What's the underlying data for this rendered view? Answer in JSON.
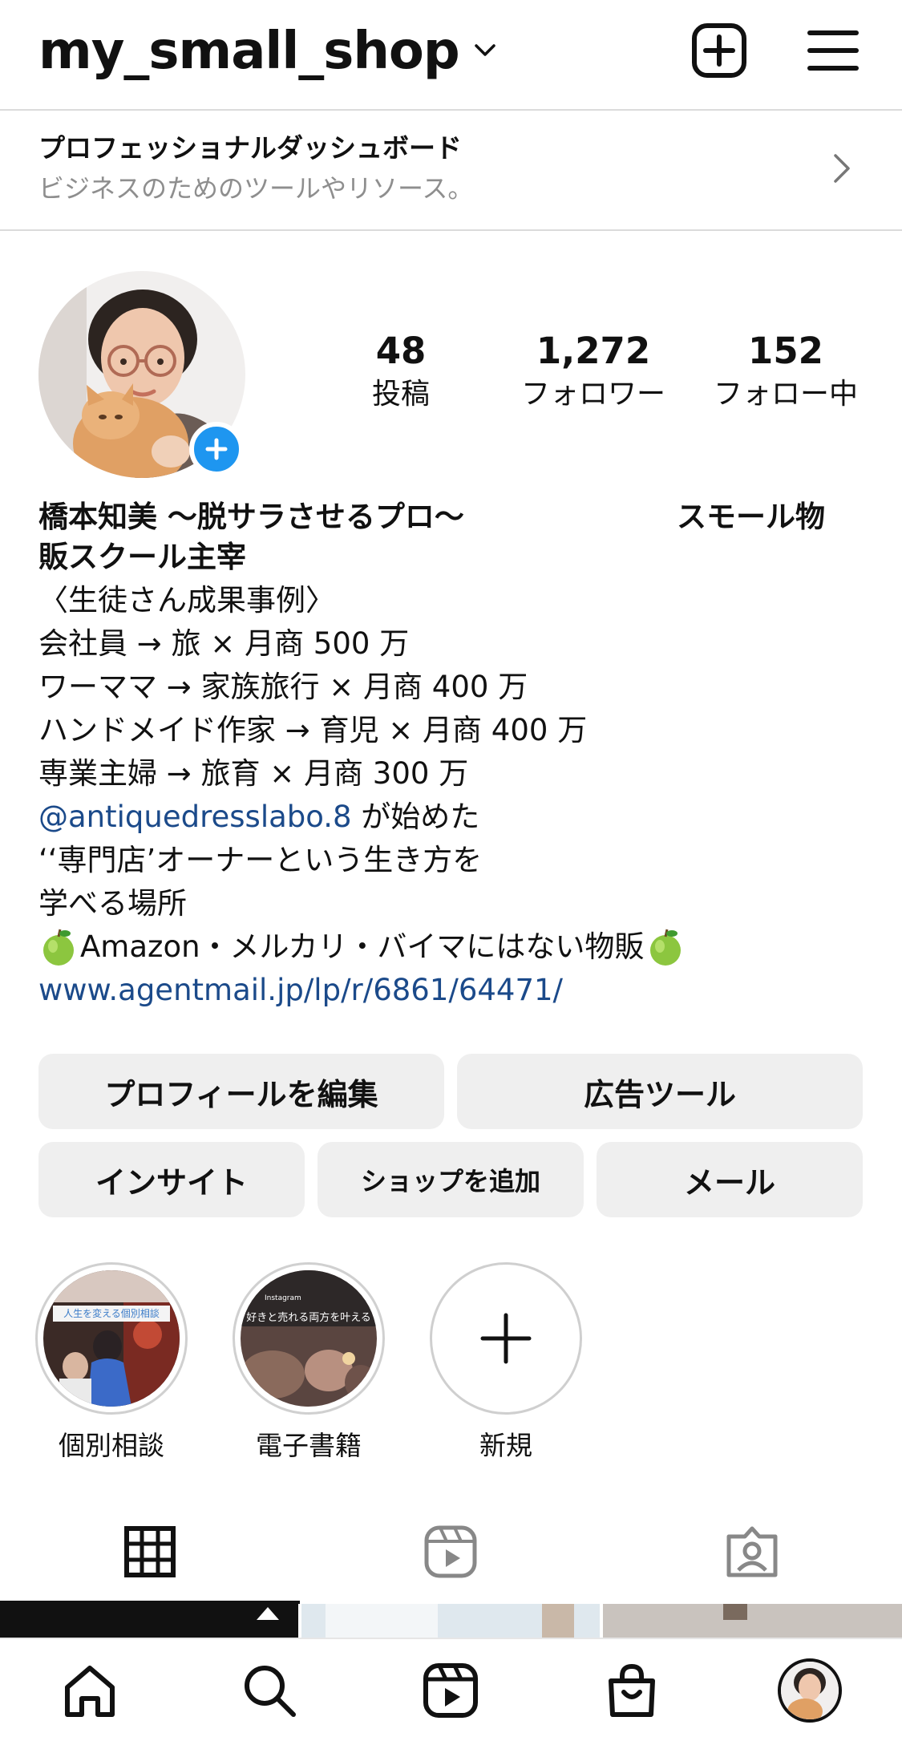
{
  "header": {
    "username": "my_small_shop"
  },
  "dashboard": {
    "title": "プロフェッショナルダッシュボード",
    "subtitle": "ビジネスのためのツールやリソース。"
  },
  "stats": [
    {
      "value": "48",
      "label": "投稿"
    },
    {
      "value": "1,272",
      "label": "フォロワー"
    },
    {
      "value": "152",
      "label": "フォロー中"
    }
  ],
  "bio": {
    "name_line1": "橋本知美 〜脱サラさせるプロ〜",
    "name_line1_right": "スモール物",
    "name_line2": "販スクール主宰",
    "lines": [
      "〈生徒さん成果事例〉",
      "会社員 → 旅 × 月商 500 万",
      "ワーママ → 家族旅行 × 月商 400 万",
      "ハンドメイド作家 → 育児 × 月商 400 万",
      "専業主婦 → 旅育 × 月商 300 万"
    ],
    "mention": "@antiquedresslabo.8",
    "mention_suffix": " が始めた",
    "line_quote": "‘‘専門店’オーナーという生き方を",
    "line_learn": "学べる場所",
    "line_apple_text": "Amazon・メルカリ・バイマにはない物販",
    "url": "www.agentmail.jp/lp/r/6861/64471/"
  },
  "buttons": {
    "edit_profile": "プロフィールを編集",
    "ad_tools": "広告ツール",
    "insights": "インサイト",
    "add_shop": "ショップを追加",
    "mail": "メール"
  },
  "highlights": [
    {
      "label": "個別相談",
      "caption": "人生を変える個別相談"
    },
    {
      "label": "電子書籍",
      "caption": "好きと売れる両方を叶える",
      "brand": "Instagram"
    },
    {
      "label": "新規"
    }
  ],
  "colors": {
    "link": "#1b4a8a",
    "add_story_blue": "#1e96f0",
    "button_bg": "#efefef",
    "divider": "#dbdbdb"
  },
  "icons": {
    "header": [
      "chevron-down-icon",
      "new-post-icon",
      "menu-icon"
    ],
    "tabs": [
      "grid-icon",
      "reels-icon",
      "tagged-icon"
    ],
    "nav": [
      "home-icon",
      "search-icon",
      "reels-icon",
      "shop-icon",
      "profile-avatar"
    ]
  }
}
